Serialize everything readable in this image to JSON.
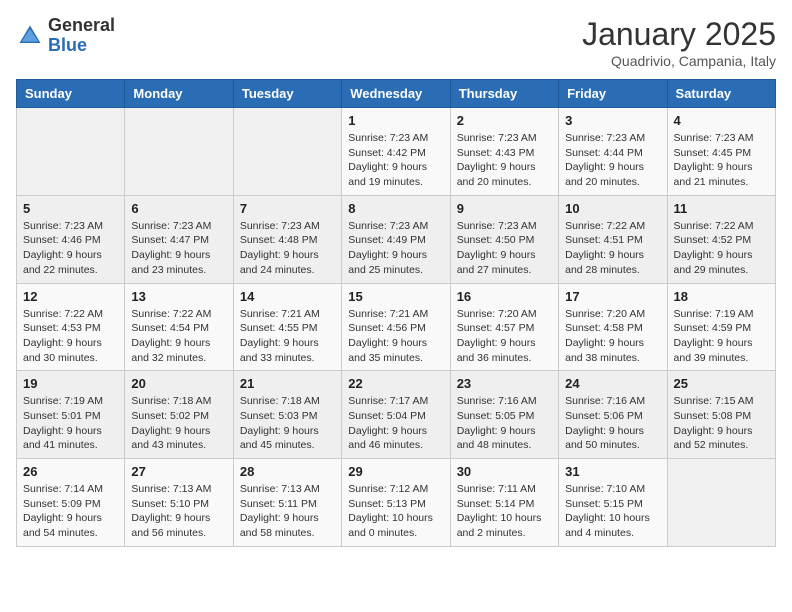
{
  "header": {
    "logo_line1": "General",
    "logo_line2": "Blue",
    "month": "January 2025",
    "location": "Quadrivio, Campania, Italy"
  },
  "weekdays": [
    "Sunday",
    "Monday",
    "Tuesday",
    "Wednesday",
    "Thursday",
    "Friday",
    "Saturday"
  ],
  "weeks": [
    [
      {
        "day": "",
        "info": ""
      },
      {
        "day": "",
        "info": ""
      },
      {
        "day": "",
        "info": ""
      },
      {
        "day": "1",
        "info": "Sunrise: 7:23 AM\nSunset: 4:42 PM\nDaylight: 9 hours\nand 19 minutes."
      },
      {
        "day": "2",
        "info": "Sunrise: 7:23 AM\nSunset: 4:43 PM\nDaylight: 9 hours\nand 20 minutes."
      },
      {
        "day": "3",
        "info": "Sunrise: 7:23 AM\nSunset: 4:44 PM\nDaylight: 9 hours\nand 20 minutes."
      },
      {
        "day": "4",
        "info": "Sunrise: 7:23 AM\nSunset: 4:45 PM\nDaylight: 9 hours\nand 21 minutes."
      }
    ],
    [
      {
        "day": "5",
        "info": "Sunrise: 7:23 AM\nSunset: 4:46 PM\nDaylight: 9 hours\nand 22 minutes."
      },
      {
        "day": "6",
        "info": "Sunrise: 7:23 AM\nSunset: 4:47 PM\nDaylight: 9 hours\nand 23 minutes."
      },
      {
        "day": "7",
        "info": "Sunrise: 7:23 AM\nSunset: 4:48 PM\nDaylight: 9 hours\nand 24 minutes."
      },
      {
        "day": "8",
        "info": "Sunrise: 7:23 AM\nSunset: 4:49 PM\nDaylight: 9 hours\nand 25 minutes."
      },
      {
        "day": "9",
        "info": "Sunrise: 7:23 AM\nSunset: 4:50 PM\nDaylight: 9 hours\nand 27 minutes."
      },
      {
        "day": "10",
        "info": "Sunrise: 7:22 AM\nSunset: 4:51 PM\nDaylight: 9 hours\nand 28 minutes."
      },
      {
        "day": "11",
        "info": "Sunrise: 7:22 AM\nSunset: 4:52 PM\nDaylight: 9 hours\nand 29 minutes."
      }
    ],
    [
      {
        "day": "12",
        "info": "Sunrise: 7:22 AM\nSunset: 4:53 PM\nDaylight: 9 hours\nand 30 minutes."
      },
      {
        "day": "13",
        "info": "Sunrise: 7:22 AM\nSunset: 4:54 PM\nDaylight: 9 hours\nand 32 minutes."
      },
      {
        "day": "14",
        "info": "Sunrise: 7:21 AM\nSunset: 4:55 PM\nDaylight: 9 hours\nand 33 minutes."
      },
      {
        "day": "15",
        "info": "Sunrise: 7:21 AM\nSunset: 4:56 PM\nDaylight: 9 hours\nand 35 minutes."
      },
      {
        "day": "16",
        "info": "Sunrise: 7:20 AM\nSunset: 4:57 PM\nDaylight: 9 hours\nand 36 minutes."
      },
      {
        "day": "17",
        "info": "Sunrise: 7:20 AM\nSunset: 4:58 PM\nDaylight: 9 hours\nand 38 minutes."
      },
      {
        "day": "18",
        "info": "Sunrise: 7:19 AM\nSunset: 4:59 PM\nDaylight: 9 hours\nand 39 minutes."
      }
    ],
    [
      {
        "day": "19",
        "info": "Sunrise: 7:19 AM\nSunset: 5:01 PM\nDaylight: 9 hours\nand 41 minutes."
      },
      {
        "day": "20",
        "info": "Sunrise: 7:18 AM\nSunset: 5:02 PM\nDaylight: 9 hours\nand 43 minutes."
      },
      {
        "day": "21",
        "info": "Sunrise: 7:18 AM\nSunset: 5:03 PM\nDaylight: 9 hours\nand 45 minutes."
      },
      {
        "day": "22",
        "info": "Sunrise: 7:17 AM\nSunset: 5:04 PM\nDaylight: 9 hours\nand 46 minutes."
      },
      {
        "day": "23",
        "info": "Sunrise: 7:16 AM\nSunset: 5:05 PM\nDaylight: 9 hours\nand 48 minutes."
      },
      {
        "day": "24",
        "info": "Sunrise: 7:16 AM\nSunset: 5:06 PM\nDaylight: 9 hours\nand 50 minutes."
      },
      {
        "day": "25",
        "info": "Sunrise: 7:15 AM\nSunset: 5:08 PM\nDaylight: 9 hours\nand 52 minutes."
      }
    ],
    [
      {
        "day": "26",
        "info": "Sunrise: 7:14 AM\nSunset: 5:09 PM\nDaylight: 9 hours\nand 54 minutes."
      },
      {
        "day": "27",
        "info": "Sunrise: 7:13 AM\nSunset: 5:10 PM\nDaylight: 9 hours\nand 56 minutes."
      },
      {
        "day": "28",
        "info": "Sunrise: 7:13 AM\nSunset: 5:11 PM\nDaylight: 9 hours\nand 58 minutes."
      },
      {
        "day": "29",
        "info": "Sunrise: 7:12 AM\nSunset: 5:13 PM\nDaylight: 10 hours\nand 0 minutes."
      },
      {
        "day": "30",
        "info": "Sunrise: 7:11 AM\nSunset: 5:14 PM\nDaylight: 10 hours\nand 2 minutes."
      },
      {
        "day": "31",
        "info": "Sunrise: 7:10 AM\nSunset: 5:15 PM\nDaylight: 10 hours\nand 4 minutes."
      },
      {
        "day": "",
        "info": ""
      }
    ]
  ]
}
